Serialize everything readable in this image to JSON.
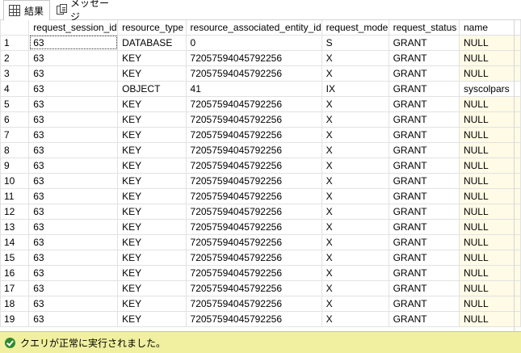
{
  "tabs": {
    "results_label": "結果",
    "messages_label": "メッセージ"
  },
  "grid": {
    "columns": [
      "request_session_id",
      "resource_type",
      "resource_associated_entity_id",
      "request_mode",
      "request_status",
      "name"
    ],
    "rows": [
      {
        "n": "1",
        "session": "63",
        "type": "DATABASE",
        "entity": "0",
        "mode": "S",
        "status": "GRANT",
        "name": "NULL"
      },
      {
        "n": "2",
        "session": "63",
        "type": "KEY",
        "entity": "72057594045792256",
        "mode": "X",
        "status": "GRANT",
        "name": "NULL"
      },
      {
        "n": "3",
        "session": "63",
        "type": "KEY",
        "entity": "72057594045792256",
        "mode": "X",
        "status": "GRANT",
        "name": "NULL"
      },
      {
        "n": "4",
        "session": "63",
        "type": "OBJECT",
        "entity": "41",
        "mode": "IX",
        "status": "GRANT",
        "name": "syscolpars"
      },
      {
        "n": "5",
        "session": "63",
        "type": "KEY",
        "entity": "72057594045792256",
        "mode": "X",
        "status": "GRANT",
        "name": "NULL"
      },
      {
        "n": "6",
        "session": "63",
        "type": "KEY",
        "entity": "72057594045792256",
        "mode": "X",
        "status": "GRANT",
        "name": "NULL"
      },
      {
        "n": "7",
        "session": "63",
        "type": "KEY",
        "entity": "72057594045792256",
        "mode": "X",
        "status": "GRANT",
        "name": "NULL"
      },
      {
        "n": "8",
        "session": "63",
        "type": "KEY",
        "entity": "72057594045792256",
        "mode": "X",
        "status": "GRANT",
        "name": "NULL"
      },
      {
        "n": "9",
        "session": "63",
        "type": "KEY",
        "entity": "72057594045792256",
        "mode": "X",
        "status": "GRANT",
        "name": "NULL"
      },
      {
        "n": "10",
        "session": "63",
        "type": "KEY",
        "entity": "72057594045792256",
        "mode": "X",
        "status": "GRANT",
        "name": "NULL"
      },
      {
        "n": "11",
        "session": "63",
        "type": "KEY",
        "entity": "72057594045792256",
        "mode": "X",
        "status": "GRANT",
        "name": "NULL"
      },
      {
        "n": "12",
        "session": "63",
        "type": "KEY",
        "entity": "72057594045792256",
        "mode": "X",
        "status": "GRANT",
        "name": "NULL"
      },
      {
        "n": "13",
        "session": "63",
        "type": "KEY",
        "entity": "72057594045792256",
        "mode": "X",
        "status": "GRANT",
        "name": "NULL"
      },
      {
        "n": "14",
        "session": "63",
        "type": "KEY",
        "entity": "72057594045792256",
        "mode": "X",
        "status": "GRANT",
        "name": "NULL"
      },
      {
        "n": "15",
        "session": "63",
        "type": "KEY",
        "entity": "72057594045792256",
        "mode": "X",
        "status": "GRANT",
        "name": "NULL"
      },
      {
        "n": "16",
        "session": "63",
        "type": "KEY",
        "entity": "72057594045792256",
        "mode": "X",
        "status": "GRANT",
        "name": "NULL"
      },
      {
        "n": "17",
        "session": "63",
        "type": "KEY",
        "entity": "72057594045792256",
        "mode": "X",
        "status": "GRANT",
        "name": "NULL"
      },
      {
        "n": "18",
        "session": "63",
        "type": "KEY",
        "entity": "72057594045792256",
        "mode": "X",
        "status": "GRANT",
        "name": "NULL"
      },
      {
        "n": "19",
        "session": "63",
        "type": "KEY",
        "entity": "72057594045792256",
        "mode": "X",
        "status": "GRANT",
        "name": "NULL"
      }
    ]
  },
  "status_bar": {
    "text": "クエリが正常に実行されました。",
    "icon": "check-circle-icon",
    "color": "#f0f0a0"
  }
}
